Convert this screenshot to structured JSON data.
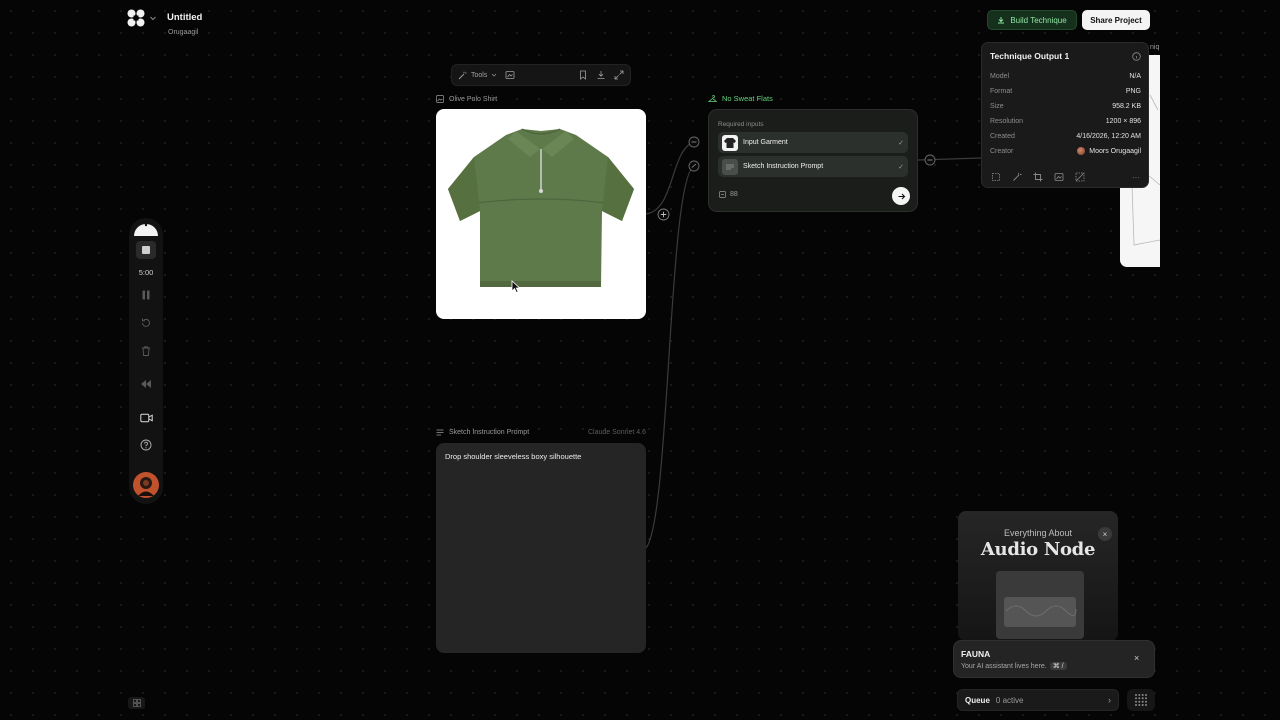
{
  "header": {
    "logo_icon": "app-logo-icon",
    "title": "Untitled",
    "subtitle": "Orugaagil"
  },
  "topbar": {
    "build_label": "Build Technique",
    "share_label": "Share Project"
  },
  "tech_panel": {
    "title": "Technique Output 1",
    "rows": [
      {
        "key": "Model",
        "value": "N/A"
      },
      {
        "key": "Format",
        "value": "PNG"
      },
      {
        "key": "Size",
        "value": "958.2 KB"
      },
      {
        "key": "Resolution",
        "value": "1200 × 896"
      },
      {
        "key": "Created",
        "value": "4/16/2026, 12:20 AM"
      },
      {
        "key": "Creator",
        "value": "Moors Orugaagil"
      }
    ],
    "more_label": "···"
  },
  "right_node": {
    "label_fragment": "niq"
  },
  "node_toolbar": {
    "tools_label": "Tools"
  },
  "image_node": {
    "label": "Olive Polo Shirt"
  },
  "flats_node": {
    "label": "No Sweat Flats",
    "required_label": "Required inputs",
    "inputs": [
      {
        "label": "Input Garment",
        "check": "✓"
      },
      {
        "label": "Sketch Instruction Prompt",
        "check": "✓"
      }
    ],
    "credits": "88"
  },
  "prompt_node": {
    "label": "Sketch Instruction Prompt",
    "model": "Claude Sonnet 4.6",
    "text": "Drop shoulder sleeveless boxy silhouette"
  },
  "left_bar": {
    "timer": "5:00"
  },
  "video_card": {
    "kicker": "Everything About",
    "title": "Audio Node",
    "close": "×"
  },
  "fauna": {
    "title": "FAUNA",
    "subtitle": "Your AI assistant lives here.",
    "shortcut": "⌘ /",
    "close": "×"
  },
  "queue": {
    "label": "Queue",
    "count": "0 active",
    "arrow": "›"
  },
  "colors": {
    "canvas_bg": "#050505",
    "accent_green": "#62d27c",
    "garment_olive": "#5f7a4a"
  }
}
